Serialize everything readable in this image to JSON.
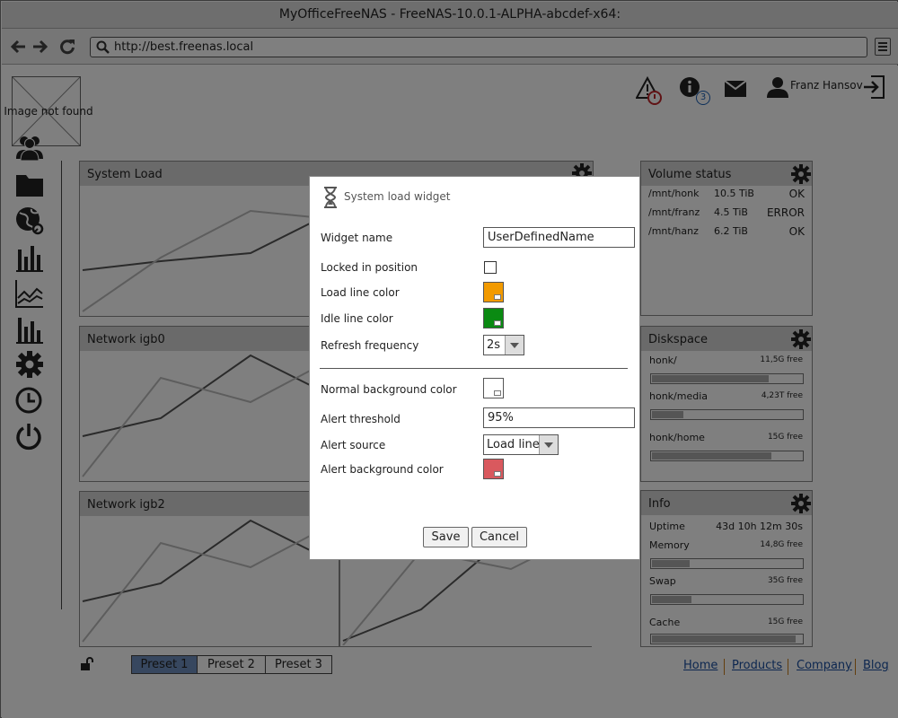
{
  "window": {
    "title": "MyOfficeFreeNAS - FreeNAS-10.0.1-ALPHA-abcdef-x64:"
  },
  "browser": {
    "url": "http://best.freenas.local",
    "back_icon": "arrow-left-icon",
    "forward_icon": "arrow-right-icon",
    "reload_icon": "reload-icon"
  },
  "logo": {
    "alt_text": "Image not found"
  },
  "header": {
    "user_name": "Franz Hansov",
    "info_count": "3",
    "alert_icon": "warning-icon",
    "info_icon": "info-icon",
    "mail_icon": "mail-icon",
    "logout_icon": "logout-icon"
  },
  "sidebar": {
    "icons": [
      "users-icon",
      "folder-icon",
      "globe-icon",
      "bar-chart-icon",
      "line-chart-icon",
      "stats-icon",
      "gear-icon",
      "clock-icon",
      "power-icon"
    ]
  },
  "widgets": {
    "system_load": {
      "title": "System Load"
    },
    "network_igb0": {
      "title": "Network igb0"
    },
    "network_igb2": {
      "title": "Network igb2"
    }
  },
  "volume_status": {
    "title": "Volume status",
    "rows": [
      {
        "path": "/mnt/honk",
        "size": "10.5 TiB",
        "status": "OK"
      },
      {
        "path": "/mnt/franz",
        "size": "4.5 TiB",
        "status": "ERROR"
      },
      {
        "path": "/mnt/hanz",
        "size": "6.2 TiB",
        "status": "OK"
      }
    ]
  },
  "diskspace": {
    "title": "Diskspace",
    "items": [
      {
        "name": "honk/",
        "free": "11,5G free",
        "used_fraction": 0.78
      },
      {
        "name": "honk/media",
        "free": "4,23T free",
        "used_fraction": 0.22
      },
      {
        "name": "honk/home",
        "free": "15G free",
        "used_fraction": 0.8
      }
    ]
  },
  "info": {
    "title": "Info",
    "uptime_label": "Uptime",
    "uptime_value": "43d 10h 12m 30s",
    "memory_label": "Memory",
    "memory_free": "14,8G free",
    "memory_used_fraction": 0.26,
    "swap_label": "Swap",
    "swap_free": "35G free",
    "swap_used_fraction": 0.27,
    "cache_label": "Cache",
    "cache_free": "15G free",
    "cache_used_fraction": 0.96
  },
  "dialog": {
    "title": "System load widget",
    "widget_name_label": "Widget name",
    "widget_name_value": "UserDefinedName",
    "locked_label": "Locked in position",
    "locked": false,
    "load_color_label": "Load line color",
    "load_color": "#f29a00",
    "idle_color_label": "Idle line color",
    "idle_color": "#0a8a12",
    "refresh_label": "Refresh frequency",
    "refresh_value": "2s",
    "normal_bg_label": "Normal background color",
    "normal_bg": "#ffffff",
    "alert_threshold_label": "Alert threshold",
    "alert_threshold_value": "95%",
    "alert_source_label": "Alert source",
    "alert_source_value": "Load line",
    "alert_bg_label": "Alert background color",
    "alert_bg": "#d9595e",
    "save_label": "Save",
    "cancel_label": "Cancel"
  },
  "presets": [
    "Preset 1",
    "Preset 2",
    "Preset 3"
  ],
  "preset_active_color": "#6f8fbf",
  "footer": {
    "links": [
      "Home",
      "Products",
      "Company",
      "Blog"
    ]
  }
}
